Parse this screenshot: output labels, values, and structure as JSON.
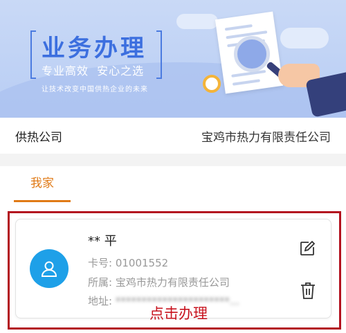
{
  "banner": {
    "title": "业务办理",
    "subtitle": "专业高效  安心之选",
    "tagline": "让技术改变中国供热企业的未来",
    "brand_color": "#3c6fdf"
  },
  "company_row": {
    "label": "供热公司",
    "value": "宝鸡市热力有限责任公司"
  },
  "tabs": [
    {
      "label": "我家",
      "active": true
    }
  ],
  "card": {
    "name": "** 平",
    "card_label": "卡号:",
    "card_number": "01001552",
    "belong_label": "所属:",
    "belong_value": "宝鸡市热力有限责任公司",
    "address_label": "地址:",
    "address_value": "**********************..."
  },
  "action_hint": "点击办理",
  "colors": {
    "accent": "#e07a16",
    "highlight": "#b3121f",
    "avatar": "#1ea0e8"
  }
}
